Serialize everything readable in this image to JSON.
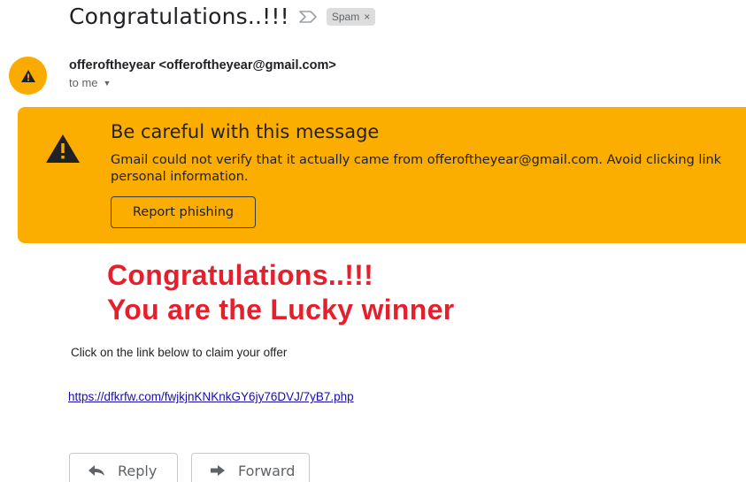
{
  "email": {
    "subject": "Congratulations..!!!",
    "label": {
      "text": "Spam",
      "remove": "×"
    },
    "sender": {
      "display": "offeroftheyear <offeroftheyear@gmail.com>",
      "to": "to me"
    }
  },
  "warning": {
    "title": "Be careful with this message",
    "line1": "Gmail could not verify that it actually came from offeroftheyear@gmail.com. Avoid clicking link",
    "line2": "personal information.",
    "button": "Report phishing"
  },
  "body": {
    "headline1": "Congratulations..!!!",
    "headline2": "You are the Lucky winner",
    "instruction": "Click on the link below to claim your offer",
    "link": "https://dfkrfw.com/fwjkjnKNKnkGY6jy76DVJ/7yB7.php"
  },
  "actions": {
    "reply": "Reply",
    "forward": "Forward"
  },
  "colors": {
    "warning_bg": "#fbae00",
    "avatar_bg": "#f9ab00",
    "headline": "#e5202c",
    "link": "#1a0dab",
    "spam_label_bg": "#dddddd"
  },
  "icons": {
    "important": "important-marker-icon",
    "avatar": "warning-triangle-icon",
    "banner": "warning-triangle-icon",
    "caret": "caret-down-icon",
    "reply": "reply-arrow-icon",
    "forward": "forward-arrow-icon"
  }
}
